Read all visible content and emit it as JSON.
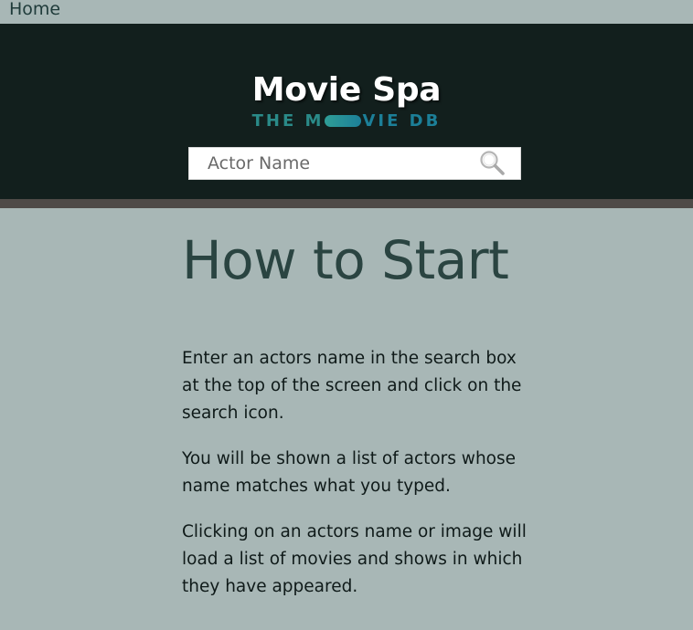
{
  "nav": {
    "home_label": "Home"
  },
  "header": {
    "title": "Movie Spa",
    "logo_text_a": "THE M",
    "logo_text_b": "VIE DB"
  },
  "search": {
    "placeholder": "Actor Name",
    "value": "",
    "icon": "search-icon"
  },
  "main": {
    "title": "How to Start",
    "paragraphs": [
      "Enter an actors name in the search box at the top of the screen and click on the search icon.",
      "You will be shown a list of actors whose name matches what you typed.",
      "Clicking on an actors name or image will load a list of movies and shows in which they have appeared."
    ]
  },
  "colors": {
    "page_background": "#a8b7b6",
    "header_background": "#121f1d",
    "header_border": "#4f4b48",
    "title_color": "#2a4441",
    "logo_teal": "#2a8a88",
    "logo_blue": "#1c7f98"
  }
}
